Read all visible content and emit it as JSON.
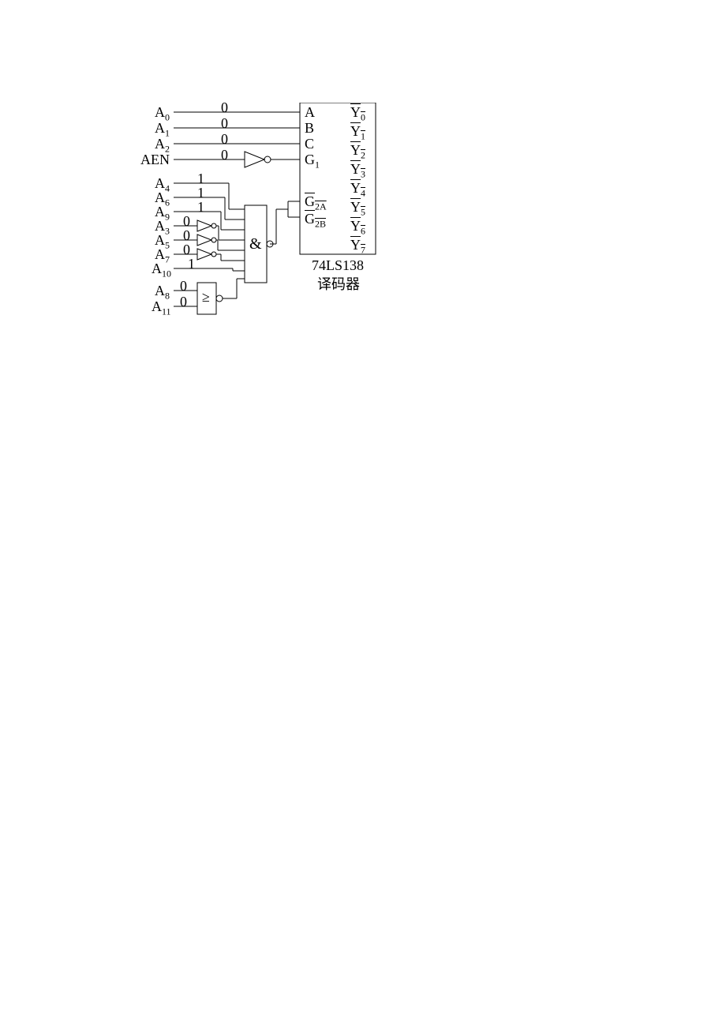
{
  "left_inputs": [
    {
      "name": "A",
      "sub": "0",
      "value": "0"
    },
    {
      "name": "A",
      "sub": "1",
      "value": "0"
    },
    {
      "name": "A",
      "sub": "2",
      "value": "0"
    },
    {
      "name": "AEN",
      "sub": "",
      "value": "0"
    },
    {
      "name": "A",
      "sub": "4",
      "value": "1"
    },
    {
      "name": "A",
      "sub": "6",
      "value": "1"
    },
    {
      "name": "A",
      "sub": "9",
      "value": "1"
    },
    {
      "name": "A",
      "sub": "3",
      "value": "0"
    },
    {
      "name": "A",
      "sub": "5",
      "value": "0"
    },
    {
      "name": "A",
      "sub": "7",
      "value": "0"
    },
    {
      "name": "A",
      "sub": "10",
      "value": "1"
    },
    {
      "name": "A",
      "sub": "8",
      "value": "0"
    },
    {
      "name": "A",
      "sub": "11",
      "value": "0"
    }
  ],
  "decoder": {
    "left_pins": [
      "A",
      "B",
      "C",
      "G"
    ],
    "left_pin_subs": [
      "",
      "",
      "",
      "1"
    ],
    "g2a": "G",
    "g2a_sub": "2A",
    "g2b": "G",
    "g2b_sub": "2B",
    "outputs": [
      "Y",
      "Y",
      "Y",
      "Y",
      "Y",
      "Y",
      "Y",
      "Y"
    ],
    "output_subs": [
      "0",
      "1",
      "2",
      "3",
      "4",
      "5",
      "6",
      "7"
    ],
    "chip_label": "74LS138",
    "chip_desc": "译码器"
  },
  "gates": {
    "and_symbol": "&",
    "or_symbol": "≥"
  }
}
